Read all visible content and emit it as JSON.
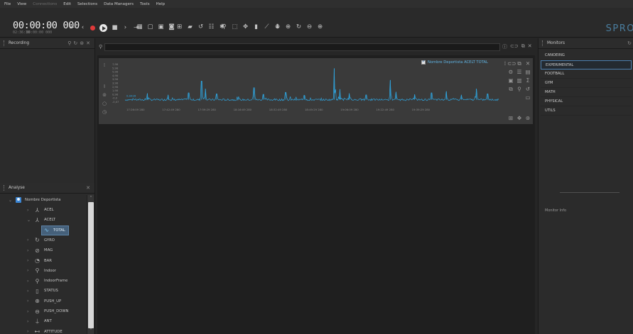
{
  "menu": [
    {
      "label": "File",
      "dim": false
    },
    {
      "label": "View",
      "dim": false
    },
    {
      "label": "Connections",
      "dim": true
    },
    {
      "label": "Edit",
      "dim": false
    },
    {
      "label": "Selections",
      "dim": false
    },
    {
      "label": "Data Managers",
      "dim": false
    },
    {
      "label": "Tools",
      "dim": false
    },
    {
      "label": "Help",
      "dim": false
    }
  ],
  "toolbar": {
    "time_main": "00:00:00 000",
    "time_start": "02:36:30",
    "time_end": "00:00:00 000",
    "brand": "SPRO"
  },
  "recording": {
    "title": "Recording"
  },
  "analyse": {
    "title": "Analyse",
    "root": "Nombre Deportista",
    "items": [
      {
        "label": "ACEL",
        "icon": "axes-icon",
        "glyph": "⅄",
        "indent": 1,
        "expanded": false
      },
      {
        "label": "ACELT",
        "icon": "axes-icon",
        "glyph": "⅄",
        "indent": 1,
        "expanded": true
      },
      {
        "label": "TOTAL",
        "icon": "signal-icon",
        "glyph": "∿",
        "indent": 2,
        "selected": true
      },
      {
        "label": "GYRO",
        "icon": "gyro-icon",
        "glyph": "↻",
        "indent": 1
      },
      {
        "label": "MAG",
        "icon": "compass-icon",
        "glyph": "⊘",
        "indent": 1
      },
      {
        "label": "BAR",
        "icon": "gauge-icon",
        "glyph": "◔",
        "indent": 1
      },
      {
        "label": "Indoor",
        "icon": "location-pin-icon",
        "glyph": "⚲",
        "indent": 1
      },
      {
        "label": "IndoorFrame",
        "icon": "location-pin-icon",
        "glyph": "⚲",
        "indent": 1
      },
      {
        "label": "STATUS",
        "icon": "document-icon",
        "glyph": "▯",
        "indent": 1
      },
      {
        "label": "PUSH_UP",
        "icon": "arrow-up-circle-icon",
        "glyph": "⊕",
        "indent": 1
      },
      {
        "label": "PUSH_DOWN",
        "icon": "arrow-down-circle-icon",
        "glyph": "⊖",
        "indent": 1
      },
      {
        "label": "ANT",
        "icon": "antenna-icon",
        "glyph": "⍊",
        "indent": 1
      },
      {
        "label": "ATTITUDE",
        "icon": "attitude-icon",
        "glyph": "⊷",
        "indent": 1
      }
    ]
  },
  "chart_data": {
    "type": "line",
    "legend": "Nombre Deportista ACELT TOTAL",
    "legend_position": "top-right",
    "series_color": "#2fa3dc",
    "yticks": [
      "7,98",
      "5,98",
      "5,98",
      "4,98",
      "3,98",
      "3,98",
      "2,98",
      "1,98",
      "0,98",
      "-0,0",
      "-0,07"
    ],
    "current_value": "0,9426",
    "xticks": [
      "17:26:09 280",
      "17:42:49 280",
      "17:59:29 280",
      "18:16:09 280",
      "18:32:49 280",
      "18:49:29 280",
      "19:06:09 280",
      "19:22:49 280",
      "19:39:29 280"
    ],
    "baseline": 0.95,
    "ylim": [
      -0.07,
      7.98
    ],
    "spikes": [
      {
        "x": 0.06,
        "y": 2.2
      },
      {
        "x": 0.115,
        "y": 1.9
      },
      {
        "x": 0.17,
        "y": 2.3
      },
      {
        "x": 0.205,
        "y": 4.6
      },
      {
        "x": 0.215,
        "y": 3.1
      },
      {
        "x": 0.245,
        "y": 2.1
      },
      {
        "x": 0.345,
        "y": 3.3
      },
      {
        "x": 0.37,
        "y": 2.0
      },
      {
        "x": 0.43,
        "y": 2.4
      },
      {
        "x": 0.48,
        "y": 1.8
      },
      {
        "x": 0.56,
        "y": 7.1
      },
      {
        "x": 0.575,
        "y": 3.0
      },
      {
        "x": 0.6,
        "y": 2.2
      },
      {
        "x": 0.645,
        "y": 1.9
      },
      {
        "x": 0.71,
        "y": 4.8
      },
      {
        "x": 0.725,
        "y": 2.5
      },
      {
        "x": 0.775,
        "y": 2.0
      },
      {
        "x": 0.82,
        "y": 2.3
      },
      {
        "x": 0.86,
        "y": 2.6
      },
      {
        "x": 0.9,
        "y": 1.9
      },
      {
        "x": 0.94,
        "y": 3.1
      },
      {
        "x": 0.97,
        "y": 2.1
      }
    ],
    "grid": false
  },
  "monitors": {
    "title": "Monitors",
    "items": [
      "CANOEING",
      "EXPERIMENTAL",
      "FOOTBALL",
      "GYM",
      "MATH",
      "PHYSICAL",
      "UTILS"
    ],
    "active_index": 1,
    "info_label": "Monitor Info"
  }
}
